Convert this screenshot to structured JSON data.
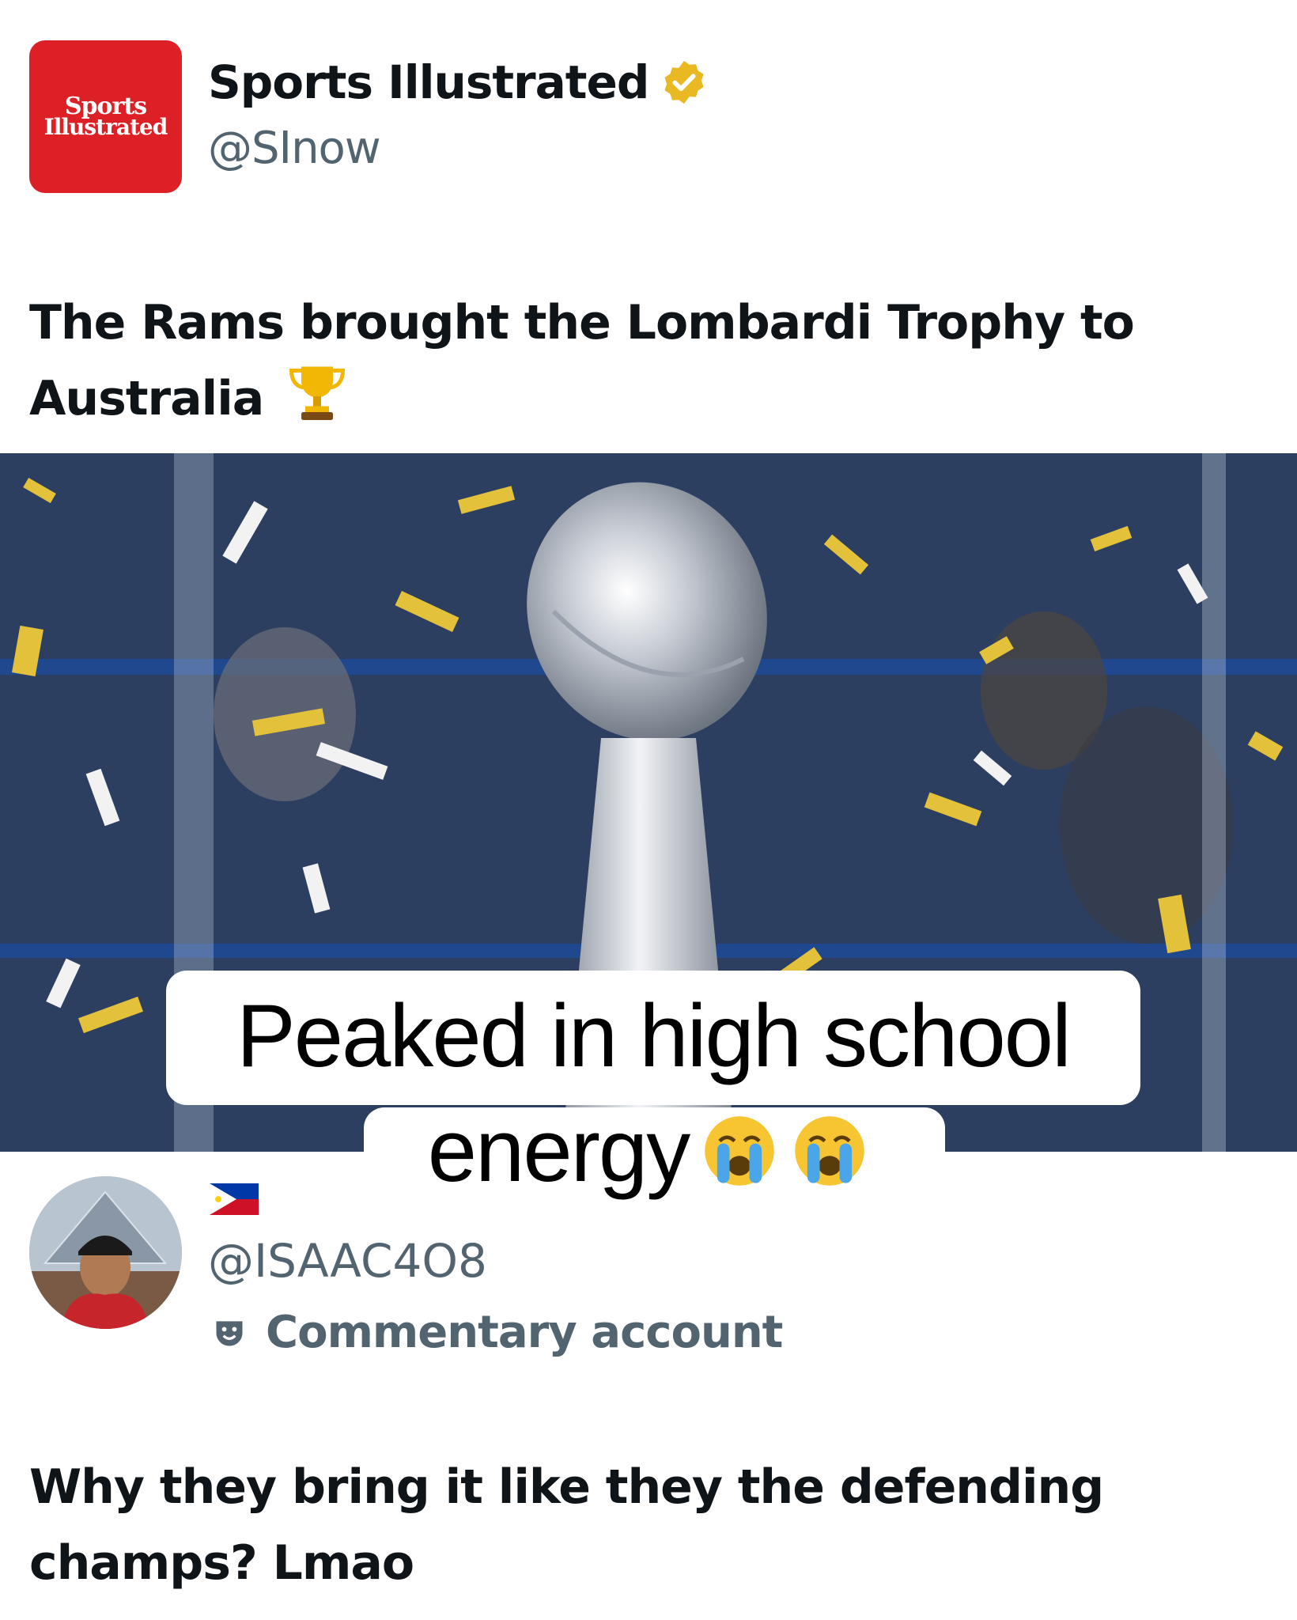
{
  "post1": {
    "logo_line1": "Sports",
    "logo_line2": "Illustrated",
    "display_name": "Sports Illustrated",
    "handle": "@SInow",
    "text": "The Rams brought the Lombardi Trophy to Australia",
    "emoji": "trophy",
    "verified_color": "#e8b923",
    "logo_color": "#dd1f26"
  },
  "media": {
    "caption_line1": "Peaked in high school",
    "caption_line2": "energy",
    "caption_emoji": "loudly-crying-face"
  },
  "post2": {
    "flag": "philippines-flag",
    "handle": "@ISAAC4O8",
    "badge_label": "Commentary account",
    "text": "Why they bring it like they the defending champs? Lmao"
  },
  "colors": {
    "text_primary": "#0f1419",
    "text_secondary": "#536471"
  }
}
